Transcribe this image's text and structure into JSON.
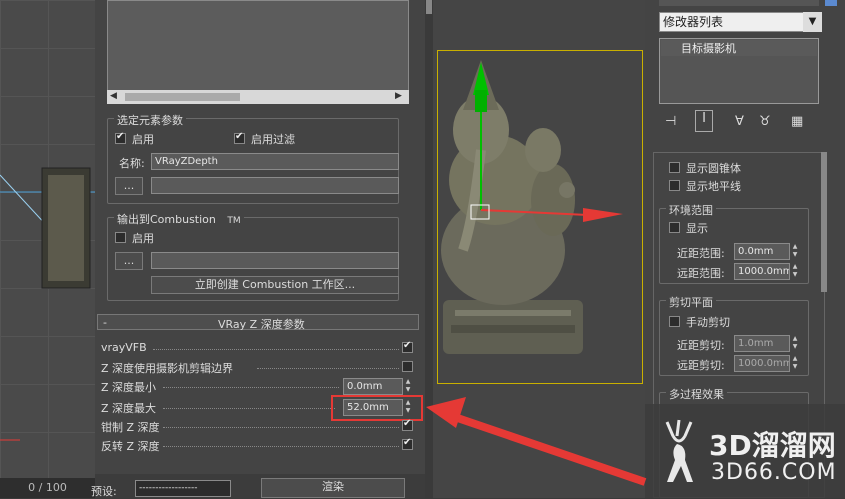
{
  "timeline": {
    "frame": "0 / 100"
  },
  "left_panel": {
    "select_params": {
      "title": "选定元素参数",
      "enable_label": "启用",
      "enable_filter_label": "启用过滤",
      "name_label": "名称:",
      "name_value": "VRayZDepth",
      "browse_label": "..."
    },
    "combustion": {
      "title": "输出到Combustion",
      "tm": "TM",
      "enable_label": "启用",
      "browse_label": "...",
      "create_button": "立即创建 Combustion 工作区..."
    },
    "vray_z": {
      "rollout_title": "VRay Z 深度参数",
      "collapse": "-",
      "rows": [
        {
          "label": "vrayVFB",
          "checked": true
        },
        {
          "label": "Z 深度使用摄影机剪辑边界",
          "checked": false
        },
        {
          "label": "Z 深度最小",
          "value": "0.0mm"
        },
        {
          "label": "Z 深度最大",
          "value": "52.0mm"
        },
        {
          "label": "钳制 Z 深度",
          "checked": true
        },
        {
          "label": "反转 Z 深度",
          "checked": true
        }
      ]
    },
    "bottom": {
      "preset_label": "预设:",
      "preset_value": "------------------",
      "render_label": "渲染"
    }
  },
  "right_panel": {
    "modifier_list": "修改器列表",
    "stack_item": "目标摄影机",
    "show_cone": "显示圆锥体",
    "show_horizon": "显示地平线",
    "env_range": {
      "title": "环境范围",
      "show_label": "显示",
      "near_label": "近距范围:",
      "near_value": "0.0mm",
      "far_label": "远距范围:",
      "far_value": "1000.0mm"
    },
    "clipping": {
      "title": "剪切平面",
      "manual_label": "手动剪切",
      "near_label": "近距剪切:",
      "near_value": "1.0mm",
      "far_label": "远距剪切:",
      "far_value": "1000.0mm"
    },
    "multipass": {
      "title": "多过程效果"
    }
  },
  "watermark": {
    "brand": "3D溜溜网",
    "url": "3D66.COM"
  },
  "colors": {
    "highlight_red": "#e53935",
    "viewport_border": "#c9b000",
    "gizmo_green": "#00c000"
  }
}
